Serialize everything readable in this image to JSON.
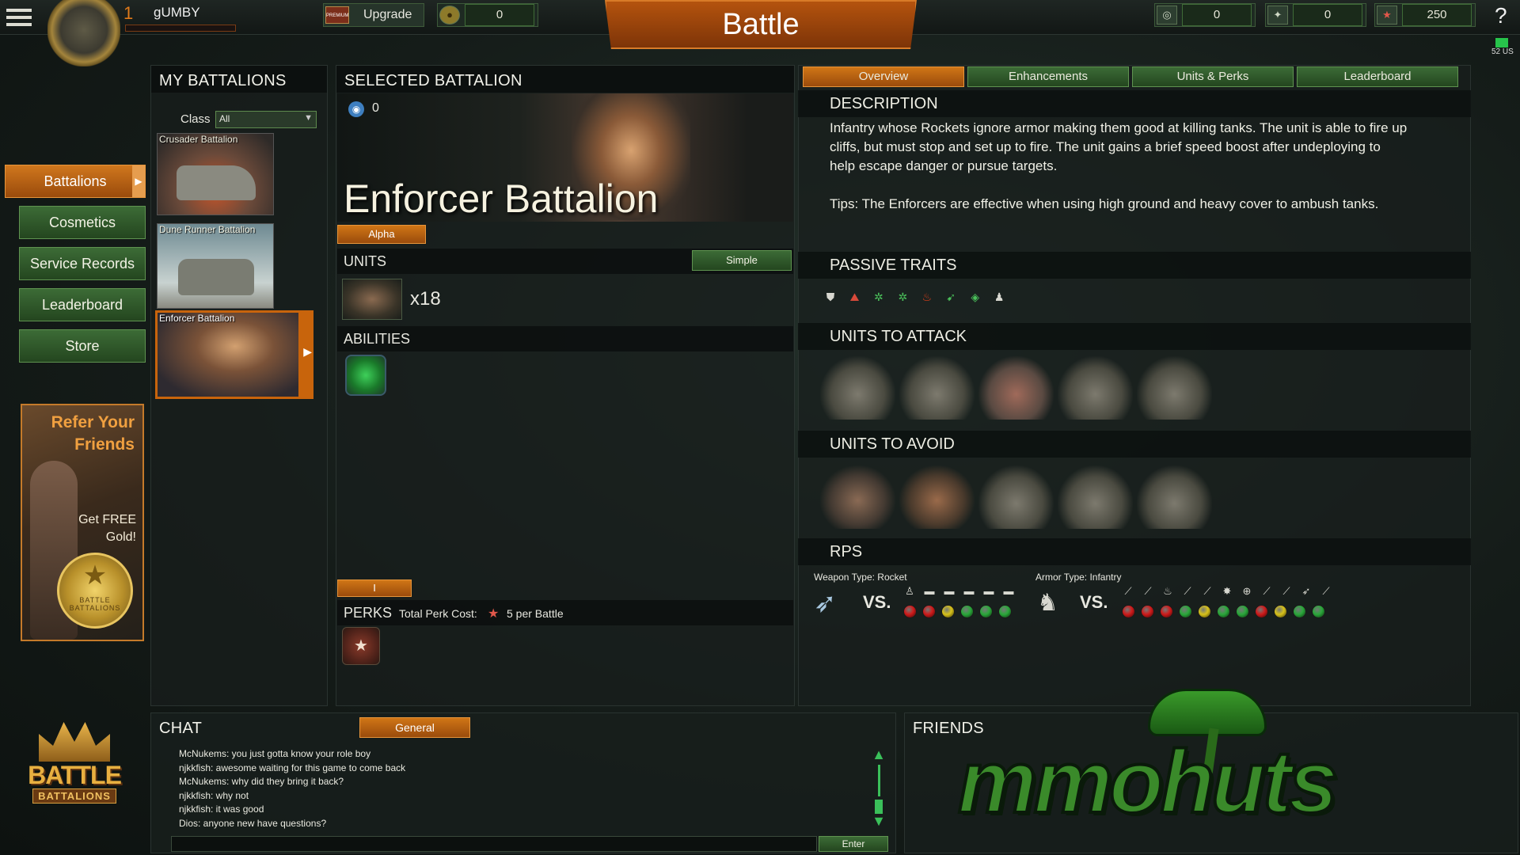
{
  "topbar": {
    "player_level": "1",
    "player_name": "gUMBY",
    "premium_label": "PREMIUM",
    "upgrade_label": "Upgrade",
    "gold_value": "0",
    "battle_label": "Battle",
    "currency1_value": "0",
    "currency2_value": "0",
    "currency3_value": "250",
    "help_label": "?",
    "ping_label": "52 US"
  },
  "sidebar": {
    "items": [
      {
        "label": "Battalions",
        "active": true
      },
      {
        "label": "Cosmetics"
      },
      {
        "label": "Service Records"
      },
      {
        "label": "Leaderboard"
      },
      {
        "label": "Store"
      }
    ],
    "refer_line1": "Refer Your",
    "refer_line2": "Friends",
    "refer_free1": "Get FREE",
    "refer_free2": "Gold!",
    "seal_text": "BATTLE BATTALIONS",
    "logo_line1": "BATTLE",
    "logo_line2": "BATTALIONS"
  },
  "my_battalions": {
    "title": "MY BATTALIONS",
    "class_label": "Class",
    "class_value": "All",
    "cards": [
      {
        "name": "Crusader Battalion"
      },
      {
        "name": "Dune Runner Battalion"
      },
      {
        "name": "Enforcer Battalion"
      }
    ]
  },
  "selected": {
    "title": "SELECTED BATTALION",
    "count": "0",
    "battalion_name": "Enforcer Battalion",
    "alpha_tag": "Alpha",
    "units_label": "UNITS",
    "simple_label": "Simple",
    "units_count": "x18",
    "abilities_label": "ABILITIES",
    "roman_tag": "I",
    "perks_label": "PERKS",
    "perk_cost_label": "Total Perk Cost:",
    "perk_cost_value": "5 per Battle"
  },
  "detail": {
    "tabs": [
      {
        "label": "Overview",
        "active": true
      },
      {
        "label": "Enhancements"
      },
      {
        "label": "Units & Perks"
      },
      {
        "label": "Leaderboard"
      }
    ],
    "description_title": "DESCRIPTION",
    "description": "Infantry whose Rockets ignore armor making them good at killing tanks. The unit is able to fire up cliffs, but must stop and set up to fire. The unit gains a brief speed boost after undeploying to help escape danger or pursue targets.",
    "tips": "Tips: The Enforcers are effective when using high ground and heavy cover to ambush tanks.",
    "passive_title": "PASSIVE TRAITS",
    "attack_title": "UNITS TO ATTACK",
    "avoid_title": "UNITS TO AVOID",
    "rps_title": "RPS",
    "weapon_type": "Weapon Type: Rocket",
    "armor_type": "Armor Type: Infantry",
    "vs": "VS.",
    "weapon_dots": [
      "red",
      "red",
      "yellow",
      "green",
      "green",
      "green"
    ],
    "armor_dots": [
      "red",
      "red",
      "red",
      "green",
      "yellow",
      "green",
      "green",
      "red",
      "yellow",
      "green",
      "green"
    ]
  },
  "chat": {
    "title": "CHAT",
    "tab": "General",
    "lines": [
      "McNukems: you just gotta know your role boy",
      "njkkfish: awesome waiting for this game to come back",
      "McNukems: why did they bring it back?",
      "njkkfish: why not",
      "njkkfish: it was good",
      "Dios: anyone new have questions?"
    ],
    "input_value": "",
    "enter_label": "Enter"
  },
  "friends": {
    "title": "FRIENDS"
  },
  "watermark": {
    "text": "mmohuts"
  },
  "colors": {
    "accent_orange": "#c8640c",
    "accent_green": "#3c6b36",
    "dot_red": "#d01a1a",
    "dot_yellow": "#d8c21a",
    "dot_green": "#2aa83a"
  }
}
